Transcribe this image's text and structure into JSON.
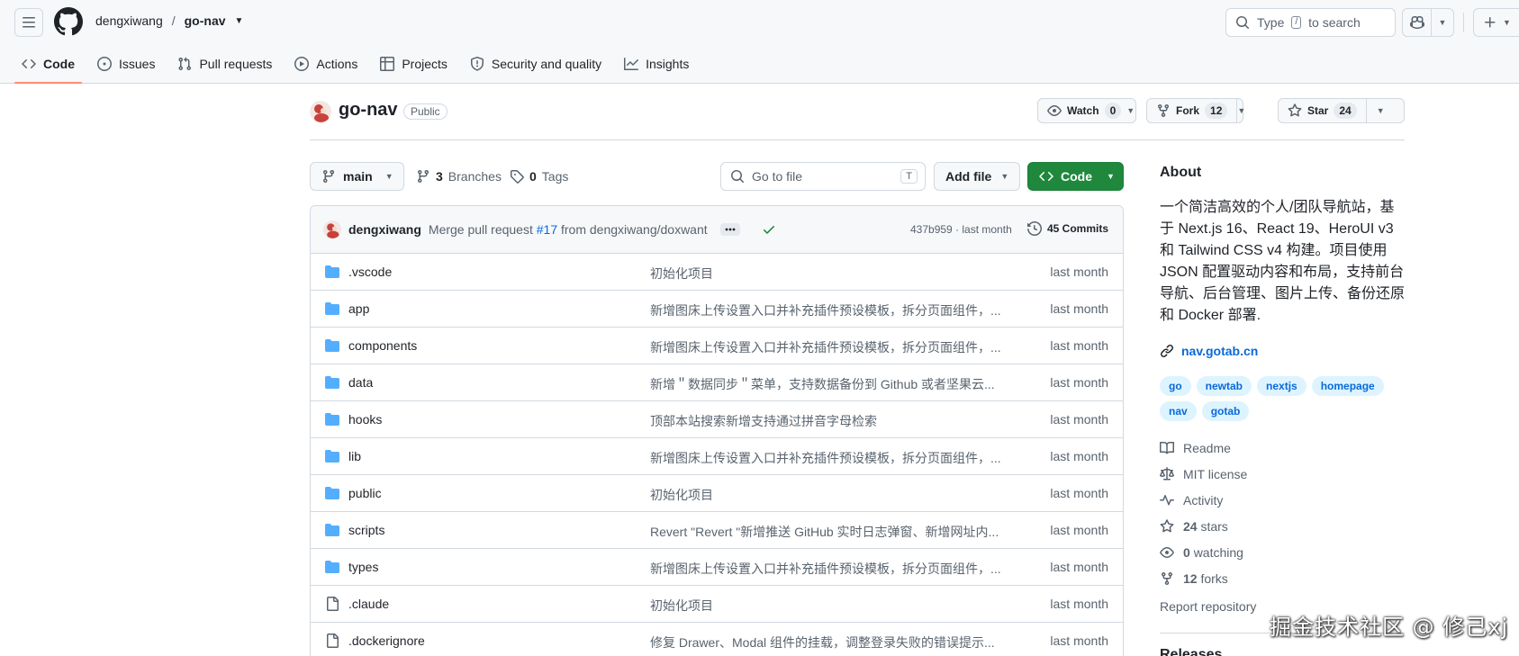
{
  "header": {
    "owner": "dengxiwang",
    "separator": "/",
    "repo": "go-nav",
    "search_prefix": "Type",
    "search_key": "/",
    "search_suffix": "to search"
  },
  "tabs": [
    {
      "label": "Code",
      "icon": "code-icon",
      "active": true
    },
    {
      "label": "Issues",
      "icon": "issue-icon"
    },
    {
      "label": "Pull requests",
      "icon": "pull-request-icon"
    },
    {
      "label": "Actions",
      "icon": "play-icon"
    },
    {
      "label": "Projects",
      "icon": "table-icon"
    },
    {
      "label": "Security and quality",
      "icon": "shield-icon"
    },
    {
      "label": "Insights",
      "icon": "graph-icon"
    }
  ],
  "repo_header": {
    "name": "go-nav",
    "visibility": "Public",
    "watch_label": "Watch",
    "watch_count": "0",
    "fork_label": "Fork",
    "fork_count": "12",
    "star_label": "Star",
    "star_count": "24"
  },
  "toolbar": {
    "branch": "main",
    "branches_count": "3",
    "branches_label": "Branches",
    "tags_count": "0",
    "tags_label": "Tags",
    "goto_placeholder": "Go to file",
    "goto_key": "T",
    "add_file": "Add file",
    "code": "Code"
  },
  "latest_commit": {
    "author": "dengxiwang",
    "message_prefix": "Merge pull request",
    "pr": "#17",
    "message_suffix": "from dengxiwang/doxwant",
    "sha_time": "437b959 · last month",
    "commits": "45 Commits"
  },
  "files": [
    {
      "type": "dir",
      "name": ".vscode",
      "message": "初始化项目",
      "time": "last month"
    },
    {
      "type": "dir",
      "name": "app",
      "message": "新增图床上传设置入口并补充插件预设模板，拆分页面组件，...",
      "time": "last month"
    },
    {
      "type": "dir",
      "name": "components",
      "message": "新增图床上传设置入口并补充插件预设模板，拆分页面组件，...",
      "time": "last month"
    },
    {
      "type": "dir",
      "name": "data",
      "message": "新增＂数据同步＂菜单，支持数据备份到 Github 或者坚果云...",
      "time": "last month"
    },
    {
      "type": "dir",
      "name": "hooks",
      "message": "顶部本站搜索新增支持通过拼音字母检索",
      "time": "last month"
    },
    {
      "type": "dir",
      "name": "lib",
      "message": "新增图床上传设置入口并补充插件预设模板，拆分页面组件，...",
      "time": "last month"
    },
    {
      "type": "dir",
      "name": "public",
      "message": "初始化项目",
      "time": "last month"
    },
    {
      "type": "dir",
      "name": "scripts",
      "message": "Revert \"Revert \"新增推送 GitHub 实时日志弹窗、新增网址内...",
      "time": "last month"
    },
    {
      "type": "dir",
      "name": "types",
      "message": "新增图床上传设置入口并补充插件预设模板，拆分页面组件，...",
      "time": "last month"
    },
    {
      "type": "file",
      "name": ".claude",
      "message": "初始化项目",
      "time": "last month"
    },
    {
      "type": "file",
      "name": ".dockerignore",
      "message": "修复 Drawer、Modal 组件的挂载，调整登录失败的错误提示...",
      "time": "last month"
    }
  ],
  "about": {
    "heading": "About",
    "description": "一个简洁高效的个人/团队导航站，基于 Next.js 16、React 19、HeroUI v3 和 Tailwind CSS v4 构建。项目使用 JSON 配置驱动内容和布局，支持前台导航、后台管理、图片上传、备份还原和 Docker 部署.",
    "homepage": "nav.gotab.cn",
    "topics": [
      "go",
      "newtab",
      "nextjs",
      "homepage",
      "nav",
      "gotab"
    ],
    "readme": "Readme",
    "license": "MIT license",
    "activity": "Activity",
    "stars_count": "24",
    "stars_label": "stars",
    "watching_count": "0",
    "watching_label": "watching",
    "forks_count": "12",
    "forks_label": "forks",
    "report": "Report repository",
    "releases_heading": "Releases"
  },
  "watermark": "掘金技术社区 @ 修己xj",
  "colors": {
    "accent_blue": "#0969da",
    "primary_green": "#1f883d",
    "folder_blue": "#54aeff",
    "tab_underline": "#fd8c73"
  }
}
